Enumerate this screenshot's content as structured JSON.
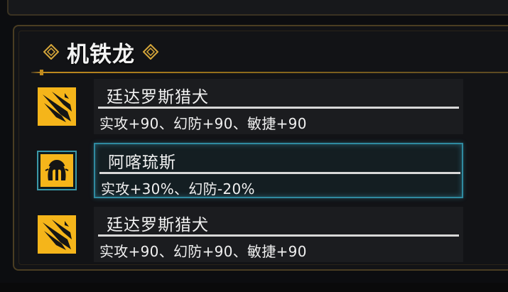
{
  "panel": {
    "title": "机铁龙",
    "title_decoration_icon": "diamond-ornament-icon"
  },
  "entries": [
    {
      "name": "廷达罗斯猎犬",
      "stats": "实攻+90、幻防+90、敏捷+90",
      "icon": "claw-slash-icon",
      "selected": false
    },
    {
      "name": "阿喀琉斯",
      "stats": "实攻+30%、幻防-20%",
      "icon": "spartan-helmet-icon",
      "selected": true
    },
    {
      "name": "廷达罗斯猎犬",
      "stats": "实攻+90、幻防+90、敏捷+90",
      "icon": "claw-slash-icon",
      "selected": false
    }
  ],
  "colors": {
    "accent_gold": "#f5b51a",
    "selection_cyan": "#2f8aa0",
    "frame_gold": "#c08a1e"
  }
}
